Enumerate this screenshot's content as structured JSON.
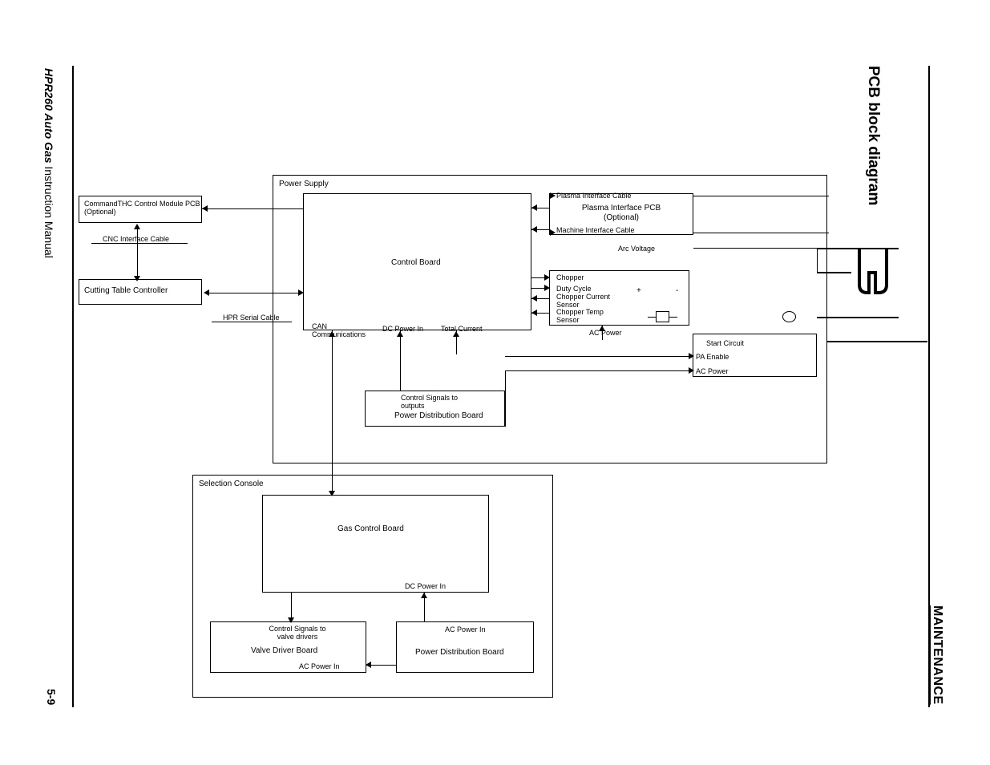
{
  "page": {
    "sectionHeader": "MAINTENANCE",
    "title": "PCB block diagram",
    "footerLeft": "HPR260 Auto Gas",
    "footerLeftSuffix": " Instruction Manual",
    "pageNumber": "5-9"
  },
  "blocks": {
    "commandTHC": "CommandTHC Control Module PCB  (Optional)",
    "cncCable": "CNC Interface Cable",
    "cuttingTable": "Cutting Table Controller",
    "hprSerial": "HPR Serial Cable",
    "powerSupply": "Power Supply",
    "controlBoard": "Control Board",
    "canComms": "CAN Communications",
    "dcPowerIn": "DC Power In",
    "totalCurrent": "Total Current",
    "plasmaCable": "Plasma Interface Cable",
    "plasmaPCB": "Plasma Interface PCB (Optional)",
    "machineCable": "Machine Interface Cable",
    "arcVoltage": "Arc Voltage",
    "chopper": "Chopper",
    "dutyCycle": "Duty Cycle",
    "chopperCurrent": "Chopper Current Sensor",
    "chopperTemp": "Chopper Temp Sensor",
    "acPower": "AC Power",
    "startCircuit": "Start Circuit",
    "paEnable": "PA Enable",
    "acPower2": "AC Power",
    "ctrlSignalsOut": "Control Signals to outputs",
    "pdb": "Power Distribution Board",
    "selectionConsole": "Selection Console",
    "gasControlBoard": "Gas Control Board",
    "dcPowerIn2": "DC Power In",
    "ctrlSignalsValve": "Control Signals to valve drivers",
    "valveDriverBoard": "Valve Driver Board",
    "acPowerIn": "AC Power In",
    "acPowerIn2": "AC Power In",
    "pdb2": "Power Distribution Board"
  }
}
